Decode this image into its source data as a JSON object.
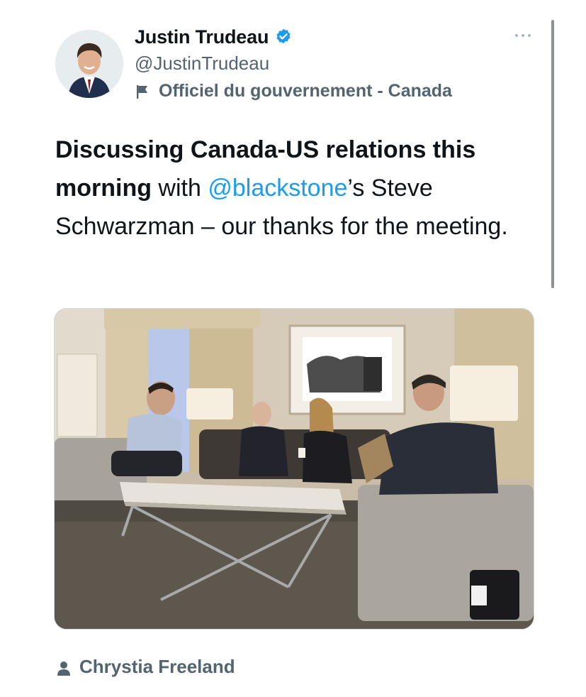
{
  "author": {
    "display_name": "Justin Trudeau",
    "handle": "@JustinTrudeau",
    "verified": true,
    "label": "Officiel du gouvernement - Canada"
  },
  "tweet": {
    "text_bold": "Discussing Canada-US relations this morning",
    "text_before_mention": " with ",
    "mention": "@blackstone",
    "text_after_mention": "’s Steve Schwarzman – our thanks for the meeting."
  },
  "media": {
    "tagged_user": "Chrystia Freeland"
  },
  "icons": {
    "verified": "verified-badge-icon",
    "label": "flag-icon",
    "more": "more-dots-icon",
    "tagged": "person-icon"
  },
  "colors": {
    "accent": "#1d9bf0",
    "secondary_text": "#536471",
    "primary_text": "#0f1419"
  }
}
